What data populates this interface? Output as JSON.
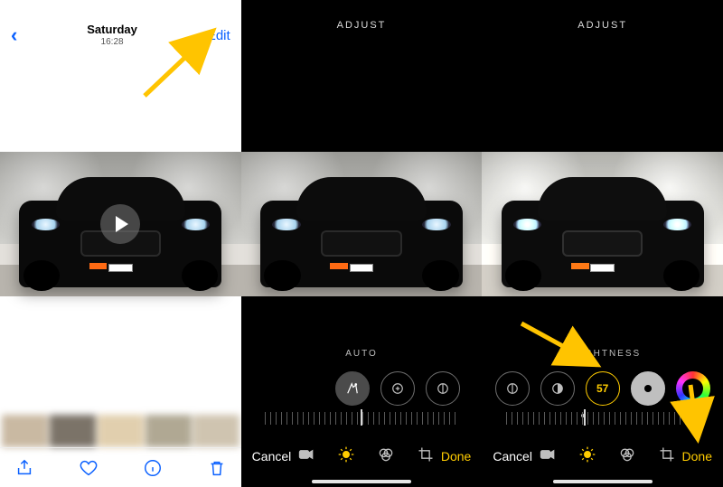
{
  "viewer": {
    "day": "Saturday",
    "time": "16:28",
    "edit_label": "Edit"
  },
  "editor2": {
    "topbar": "ADJUST",
    "adjust_label": "AUTO",
    "cancel_label": "Cancel",
    "done_label": "Done"
  },
  "editor3": {
    "topbar": "ADJUST",
    "adjust_label": "BRIGHTNESS",
    "selected_value": "57",
    "cancel_label": "Cancel",
    "done_label": "Done"
  },
  "colors": {
    "ios_blue": "#0a60ff",
    "ios_yellow": "#ffcc00"
  }
}
